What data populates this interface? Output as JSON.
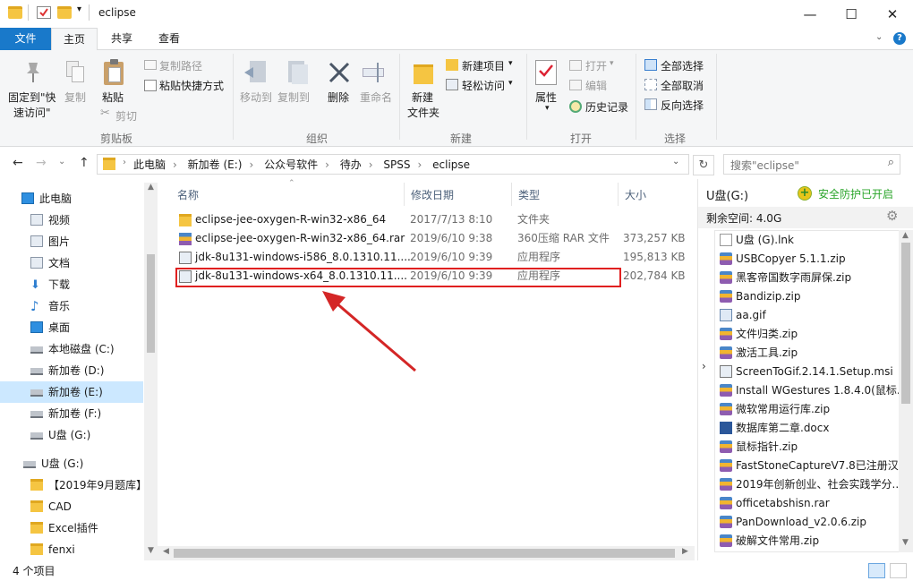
{
  "window": {
    "title": "eclipse",
    "minimize": "—",
    "maximize": "☐",
    "close": "✕"
  },
  "tabs": {
    "file": "文件",
    "home": "主页",
    "share": "共享",
    "view": "查看"
  },
  "ribbon": {
    "pin_line1": "固定到\"快",
    "pin_line2": "速访问\"",
    "copy": "复制",
    "paste": "粘贴",
    "copy_path": "复制路径",
    "paste_shortcut": "粘贴快捷方式",
    "cut": "剪切",
    "group_clipboard": "剪贴板",
    "move_to": "移动到",
    "copy_to": "复制到",
    "delete": "删除",
    "rename": "重命名",
    "group_organize": "组织",
    "new_folder_line1": "新建",
    "new_folder_line2": "文件夹",
    "new_item": "新建项目",
    "easy_access": "轻松访问",
    "group_new": "新建",
    "properties": "属性",
    "open": "打开",
    "edit": "编辑",
    "history": "历史记录",
    "group_open": "打开",
    "select_all": "全部选择",
    "select_none": "全部取消",
    "invert": "反向选择",
    "group_select": "选择"
  },
  "address": {
    "crumbs": [
      "此电脑",
      "新加卷 (E:)",
      "公众号软件",
      "待办",
      "SPSS",
      "eclipse"
    ],
    "search_placeholder": "搜索\"eclipse\""
  },
  "nav": [
    {
      "label": "此电脑",
      "icon": "computer-icon",
      "indent": 0
    },
    {
      "label": "视频",
      "icon": "video-icon",
      "indent": 1
    },
    {
      "label": "图片",
      "icon": "pictures-icon",
      "indent": 1
    },
    {
      "label": "文档",
      "icon": "documents-icon",
      "indent": 1
    },
    {
      "label": "下载",
      "icon": "download-icon",
      "indent": 1
    },
    {
      "label": "音乐",
      "icon": "music-icon",
      "indent": 1
    },
    {
      "label": "桌面",
      "icon": "desktop-icon",
      "indent": 1
    },
    {
      "label": "本地磁盘 (C:)",
      "icon": "drive-icon",
      "indent": 1
    },
    {
      "label": "新加卷 (D:)",
      "icon": "drive-icon",
      "indent": 1
    },
    {
      "label": "新加卷 (E:)",
      "icon": "drive-icon",
      "indent": 1,
      "selected": true
    },
    {
      "label": "新加卷 (F:)",
      "icon": "drive-icon",
      "indent": 1
    },
    {
      "label": "U盘 (G:)",
      "icon": "usb-drive-icon",
      "indent": 1
    },
    {
      "label": "U盘 (G:)",
      "icon": "usb-drive-icon",
      "indent": 0
    },
    {
      "label": "【2019年9月题库】",
      "icon": "folder-icon",
      "indent": 1
    },
    {
      "label": "CAD",
      "icon": "folder-icon",
      "indent": 1
    },
    {
      "label": "Excel插件",
      "icon": "folder-icon",
      "indent": 1
    },
    {
      "label": "fenxi",
      "icon": "folder-icon",
      "indent": 1
    }
  ],
  "columns": {
    "name": "名称",
    "modified": "修改日期",
    "type": "类型",
    "size": "大小"
  },
  "files": [
    {
      "name": "eclipse-jee-oxygen-R-win32-x86_64",
      "date": "2017/7/13 8:10",
      "type": "文件夹",
      "size": "",
      "icon": "folder-icon"
    },
    {
      "name": "eclipse-jee-oxygen-R-win32-x86_64.rar",
      "date": "2019/6/10 9:38",
      "type": "360压缩 RAR 文件",
      "size": "373,257 KB",
      "icon": "rar-icon"
    },
    {
      "name": "jdk-8u131-windows-i586_8.0.1310.11....",
      "date": "2019/6/10 9:39",
      "type": "应用程序",
      "size": "195,813 KB",
      "icon": "installer-icon"
    },
    {
      "name": "jdk-8u131-windows-x64_8.0.1310.11....",
      "date": "2019/6/10 9:39",
      "type": "应用程序",
      "size": "202,784 KB",
      "icon": "installer-icon",
      "highlighted": true
    }
  ],
  "preview": {
    "drive": "U盘(G:)",
    "protect": "安全防护已开启",
    "free_space": "剩余空间: 4.0G",
    "items": [
      {
        "label": "U盘 (G).lnk",
        "kind": "doc"
      },
      {
        "label": "USBCopyer 5.1.1.zip",
        "kind": "zip"
      },
      {
        "label": "黑客帝国数字雨屏保.zip",
        "kind": "zip"
      },
      {
        "label": "Bandizip.zip",
        "kind": "zip"
      },
      {
        "label": "aa.gif",
        "kind": "img"
      },
      {
        "label": "文件归类.zip",
        "kind": "zip"
      },
      {
        "label": "激活工具.zip",
        "kind": "zip"
      },
      {
        "label": "ScreenToGif.2.14.1.Setup.msi",
        "kind": "msi"
      },
      {
        "label": "Install WGestures 1.8.4.0(鼠标...",
        "kind": "zip"
      },
      {
        "label": "微软常用运行库.zip",
        "kind": "zip"
      },
      {
        "label": "数据库第二章.docx",
        "kind": "word"
      },
      {
        "label": "鼠标指针.zip",
        "kind": "zip"
      },
      {
        "label": "FastStoneCaptureV7.8已注册汉...",
        "kind": "zip"
      },
      {
        "label": "2019年创新创业、社会实践学分...",
        "kind": "zip"
      },
      {
        "label": "officetabshisn.rar",
        "kind": "zip"
      },
      {
        "label": "PanDownload_v2.0.6.zip",
        "kind": "zip"
      },
      {
        "label": "破解文件常用.zip",
        "kind": "zip"
      }
    ]
  },
  "status": {
    "count": "4 个项目"
  },
  "colors": {
    "accent": "#1979ca",
    "selected_nav": "#cce8ff",
    "highlight_box": "#e02020",
    "arrow": "#d42626",
    "green": "#2aa52a"
  }
}
